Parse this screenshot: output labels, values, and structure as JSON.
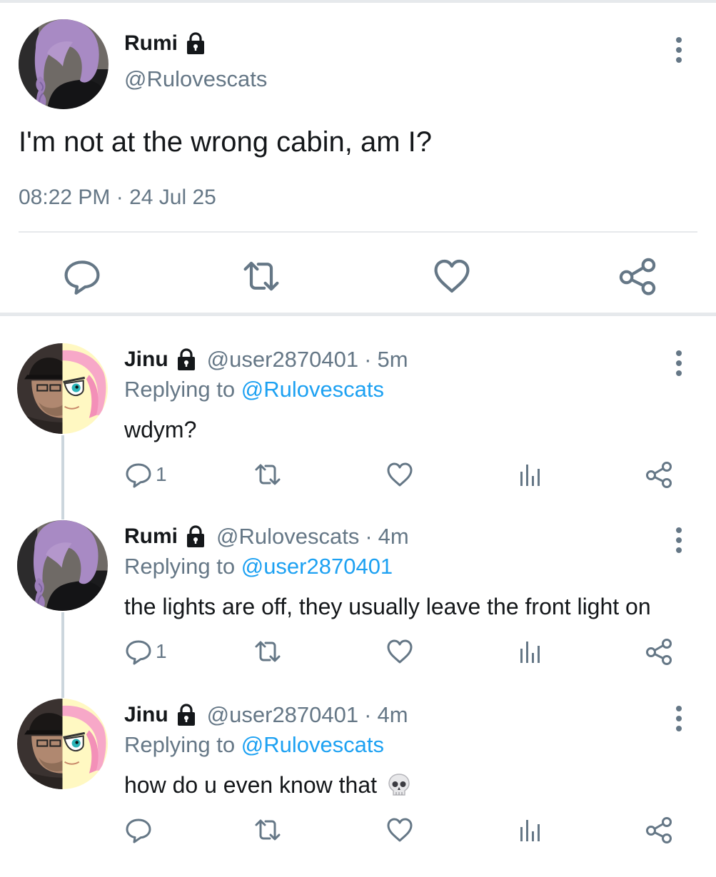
{
  "main_tweet": {
    "display_name": "Rumi",
    "handle": "@Rulovescats",
    "text": "I'm not at the wrong cabin, am I?",
    "timestamp": "08:22 PM · 24 Jul 25",
    "lock_icon": "lock-icon",
    "actions": [
      "reply-icon",
      "retweet-icon",
      "like-icon",
      "share-icon"
    ]
  },
  "replies": [
    {
      "display_name": "Jinu",
      "handle": "@user2870401",
      "separator": "·",
      "time": "5m",
      "replying_prefix": "Replying to",
      "replying_to": "@Rulovescats",
      "text": "wdym?",
      "reply_count": "1",
      "trailing_emoji": ""
    },
    {
      "display_name": "Rumi",
      "handle": "@Rulovescats",
      "separator": "·",
      "time": "4m",
      "replying_prefix": "Replying to",
      "replying_to": "@user2870401",
      "text": "the lights are off, they usually leave the front light on",
      "reply_count": "1",
      "trailing_emoji": ""
    },
    {
      "display_name": "Jinu",
      "handle": "@user2870401",
      "separator": "·",
      "time": "4m",
      "replying_prefix": "Replying to",
      "replying_to": "@Rulovescats",
      "text": "how do u even know that",
      "reply_count": "",
      "trailing_emoji": "skull-emoji"
    }
  ],
  "colors": {
    "text": "#14171a",
    "secondary": "#657786",
    "link": "#1da1f2",
    "divider": "#e6e9ec",
    "thread_line": "#ccd6dd"
  }
}
